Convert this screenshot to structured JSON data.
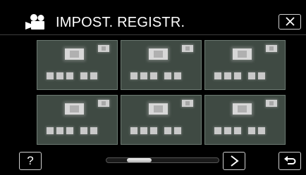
{
  "header": {
    "icon": "video-camera-icon",
    "title": "IMPOST. REGISTR.",
    "close_icon": "close-icon"
  },
  "grid": {
    "tile_count": 6,
    "tile_color": "#3f4a43",
    "tile_border_color": "#6c7a72"
  },
  "footer": {
    "help_label": "?",
    "next_icon": "chevron-right-icon",
    "back_icon": "return-icon",
    "scroll_position_fraction": 0.18,
    "scroll_thumb_fraction": 0.22
  },
  "colors": {
    "background": "#000000",
    "text": "#ffffff",
    "button_border": "#d0d0d0"
  }
}
